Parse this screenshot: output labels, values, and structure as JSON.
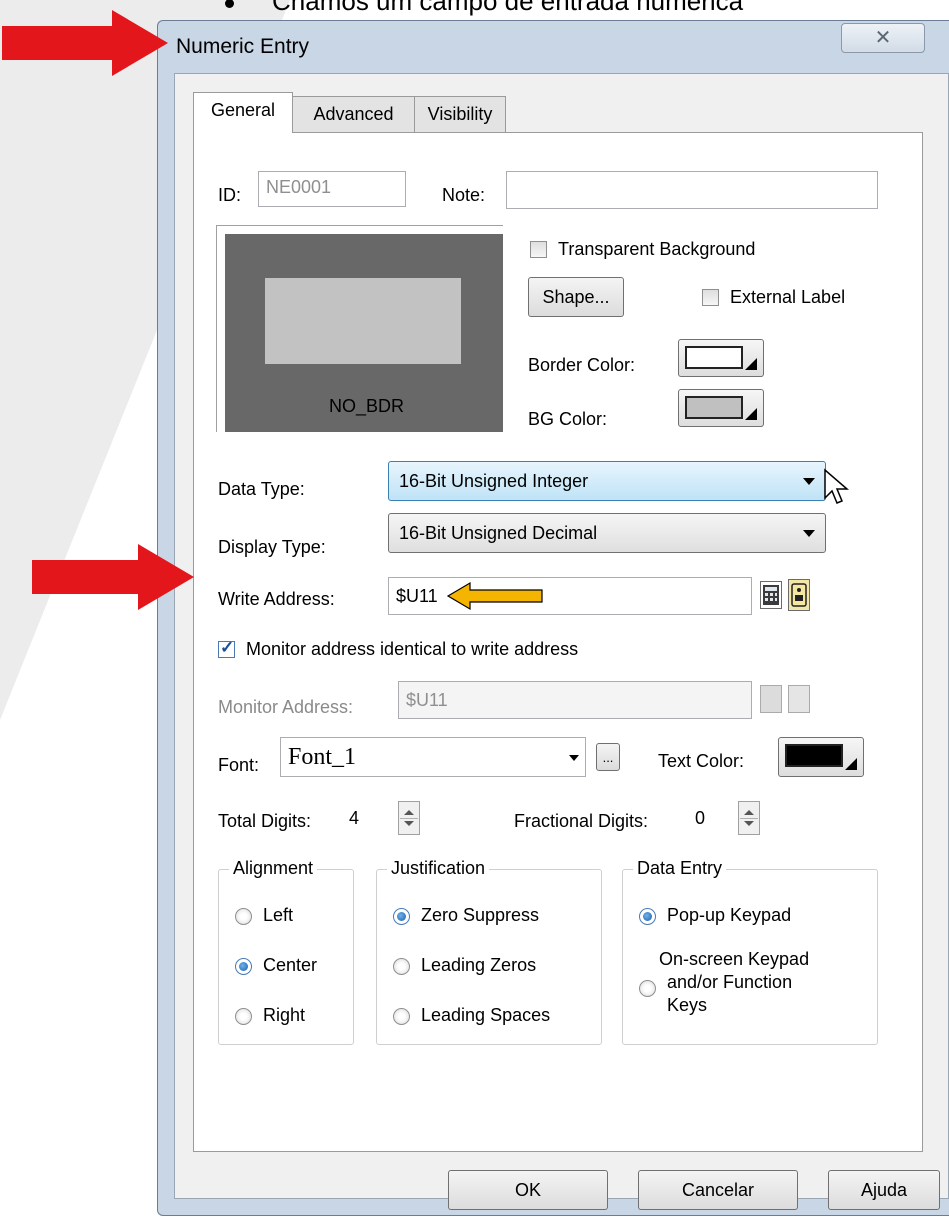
{
  "slide_caption": "Chamos um campo de entrada numérica",
  "window": {
    "title": "Numeric Entry",
    "close_glyph": "✕"
  },
  "tabs": [
    {
      "label": "General",
      "active": true
    },
    {
      "label": "Advanced",
      "active": false
    },
    {
      "label": "Visibility",
      "active": false
    }
  ],
  "general": {
    "id_label": "ID:",
    "id_value": "NE0001",
    "note_label": "Note:",
    "note_value": "",
    "preview_label": "NO_BDR",
    "transparent_bg_label": "Transparent Background",
    "transparent_bg_checked": false,
    "shape_button": "Shape...",
    "external_label_label": "External Label",
    "external_label_checked": false,
    "border_color_label": "Border Color:",
    "border_color": "#ffffff",
    "bg_color_label": "BG Color:",
    "bg_color": "#c0c0c0",
    "data_type_label": "Data Type:",
    "data_type_value": "16-Bit Unsigned Integer",
    "display_type_label": "Display Type:",
    "display_type_value": "16-Bit Unsigned Decimal",
    "write_address_label": "Write Address:",
    "write_address_value": "$U11",
    "monitor_identical_label": "Monitor address identical to write address",
    "monitor_identical_checked": true,
    "monitor_address_label": "Monitor Address:",
    "monitor_address_value": "$U11",
    "font_label": "Font:",
    "font_value": "Font_1",
    "font_browse": "...",
    "text_color_label": "Text Color:",
    "text_color": "#000000",
    "total_digits_label": "Total Digits:",
    "total_digits_value": "4",
    "fractional_digits_label": "Fractional Digits:",
    "fractional_digits_value": "0",
    "alignment": {
      "title": "Alignment",
      "options": [
        "Left",
        "Center",
        "Right"
      ],
      "selected": "Center"
    },
    "justification": {
      "title": "Justification",
      "options": [
        "Zero Suppress",
        "Leading Zeros",
        "Leading Spaces"
      ],
      "selected": "Zero Suppress"
    },
    "data_entry": {
      "title": "Data Entry",
      "option1": "Pop-up Keypad",
      "option2_line1": "On-screen Keypad",
      "option2_line2": "and/or Function",
      "option2_line3": "Keys",
      "selected": "Pop-up Keypad"
    }
  },
  "footer": {
    "ok": "OK",
    "cancel": "Cancelar",
    "help": "Ajuda"
  },
  "colors": {
    "arrow_red": "#e3161b",
    "arrow_yellow": "#f4b400",
    "preview_frame": "#686868",
    "preview_inner": "#c2c2c2"
  }
}
